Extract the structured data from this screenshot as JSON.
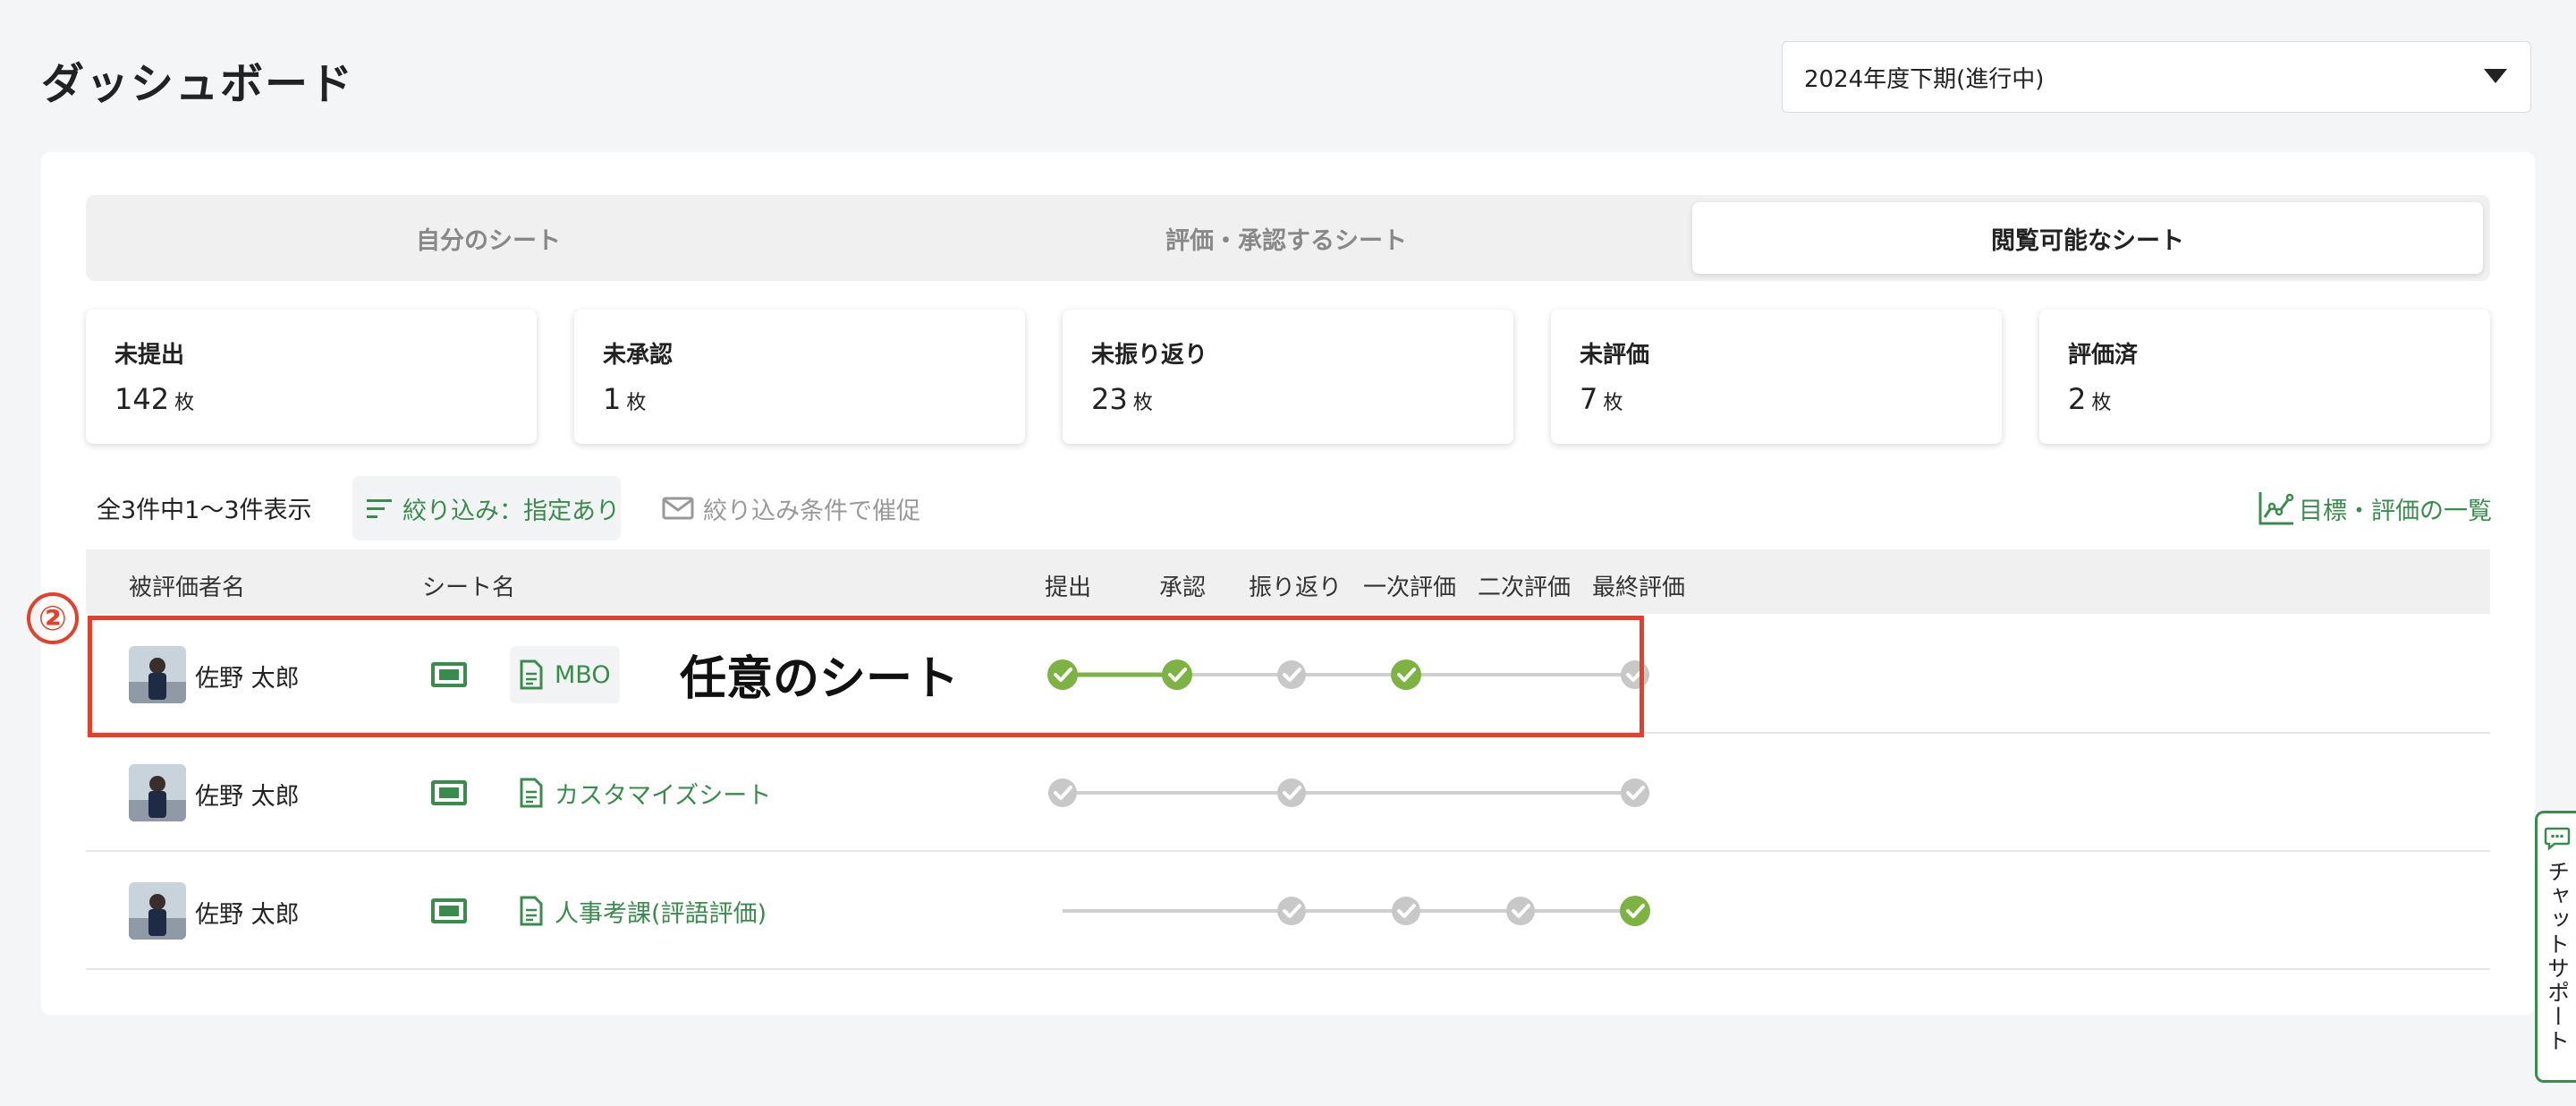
{
  "page": {
    "title": "ダッシュボード",
    "period": "2024年度下期(進行中)"
  },
  "tabs": [
    {
      "label": "自分のシート",
      "active": false
    },
    {
      "label": "評価・承認するシート",
      "active": false
    },
    {
      "label": "閲覧可能なシート",
      "active": true
    }
  ],
  "stats": [
    {
      "label": "未提出",
      "value": "142",
      "unit": "枚"
    },
    {
      "label": "未承認",
      "value": "1",
      "unit": "枚"
    },
    {
      "label": "未振り返り",
      "value": "23",
      "unit": "枚"
    },
    {
      "label": "未評価",
      "value": "7",
      "unit": "枚"
    },
    {
      "label": "評価済",
      "value": "2",
      "unit": "枚"
    }
  ],
  "toolbar": {
    "count_text": "全3件中1〜3件表示",
    "filter_label": "絞り込み：指定あり",
    "remind_label": "絞り込み条件で催促",
    "list_label": "目標・評価の一覧"
  },
  "table": {
    "headers": {
      "name": "被評価者名",
      "sheet": "シート名",
      "steps": [
        "提出",
        "承認",
        "振り返り",
        "一次評価",
        "二次評価",
        "最終評価"
      ]
    },
    "rows": [
      {
        "name": "佐野 太郎",
        "sheet": "MBO",
        "steps": [
          "done",
          "done",
          "pending",
          "done",
          "none",
          "pending"
        ],
        "line": [
          "green",
          "gray",
          "gray",
          "gray",
          "gray"
        ]
      },
      {
        "name": "佐野 太郎",
        "sheet": "カスタマイズシート",
        "steps": [
          "pending",
          "none",
          "pending",
          "none",
          "none",
          "pending"
        ],
        "line": [
          "gray",
          "gray",
          "gray",
          "gray",
          "gray"
        ]
      },
      {
        "name": "佐野 太郎",
        "sheet": "人事考課(評語評価)",
        "steps": [
          "none",
          "none",
          "pending",
          "pending",
          "pending",
          "done"
        ],
        "line": [
          "gray",
          "gray",
          "gray",
          "gray",
          "gray"
        ]
      }
    ]
  },
  "annotation": {
    "marker": "②",
    "text": "任意のシート"
  },
  "chat": {
    "label": "チャットサポート"
  },
  "colors": {
    "accent": "#3a8c4c",
    "done": "#7cb342",
    "pending": "#c8c8c8",
    "highlight": "#e5402b"
  }
}
